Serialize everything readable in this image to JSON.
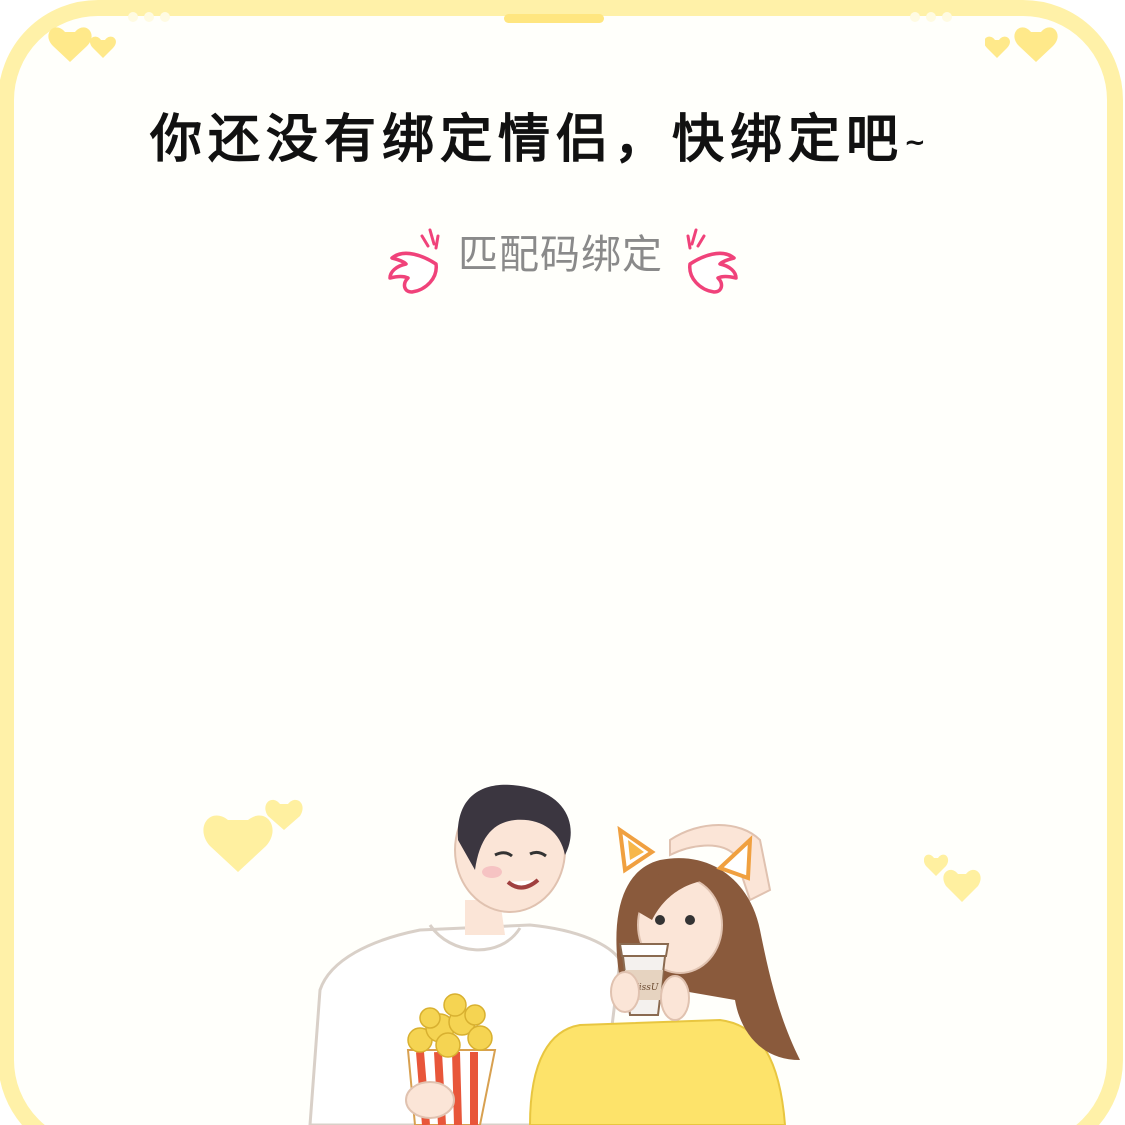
{
  "headline": {
    "main": "你还没有绑定情侣，快绑定吧",
    "tilde": "~"
  },
  "bind_button": {
    "label": "匹配码绑定"
  },
  "illustration": {
    "cup_text": "KissU"
  },
  "colors": {
    "frame": "#fff1a8",
    "wing_accent": "#f0427a",
    "heart_yellow": "#fff0a0"
  },
  "icons": [
    "heart-icon",
    "wing-icon",
    "couple-illustration"
  ]
}
